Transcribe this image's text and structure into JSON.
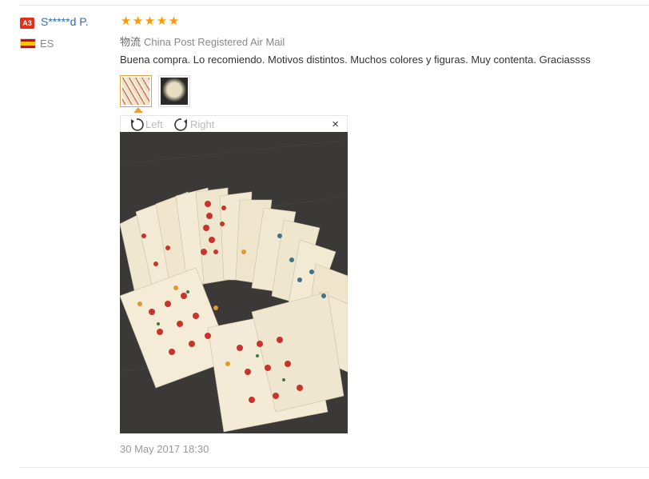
{
  "buyer": {
    "badge": "A3",
    "name": "S*****d P.",
    "country": "ES",
    "flag_icon": "spain-flag-icon"
  },
  "rating": {
    "stars": 5,
    "max": 5,
    "color": "#ff9900"
  },
  "shipping": {
    "label": "物流",
    "method": "China Post Registered Air Mail"
  },
  "review_text": "Buena compra. Lo recomiendo. Motivos distintos. Muchos colores y figuras. Muy contenta. Graciassss",
  "thumbnails": [
    {
      "name": "photo-thumbnail-1",
      "selected": true
    },
    {
      "name": "photo-thumbnail-2",
      "selected": false
    }
  ],
  "viewer": {
    "rotate_left_label": "Left",
    "rotate_right_label": "Right",
    "close_symbol": "×"
  },
  "date": "30 May 2017 18:30",
  "colors": {
    "link": "#2a6bb8",
    "badge": "#e0301e",
    "selected_border": "#e6a23c"
  }
}
